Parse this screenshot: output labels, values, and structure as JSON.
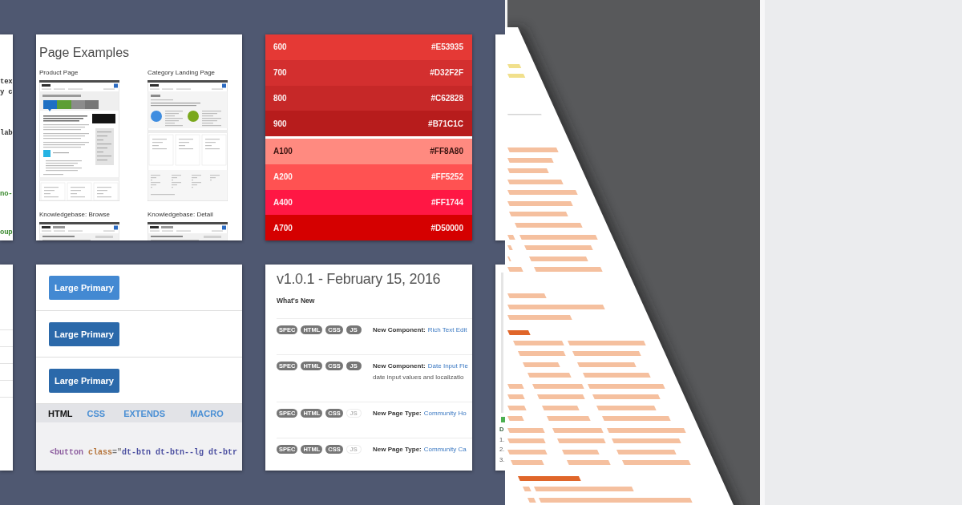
{
  "code_card": {
    "lines": [
      {
        "text": "tex",
        "color": "#333333"
      },
      {
        "text": "y c",
        "color": "#333333"
      },
      {
        "text": "lab",
        "color": "#333333"
      },
      {
        "text": "no-",
        "color": "#3a8a2e"
      },
      {
        "text": "oup",
        "color": "#3a8a2e"
      }
    ]
  },
  "page_examples_card": {
    "title": "Page Examples",
    "examples": [
      {
        "label": "Product Page",
        "kind": "product"
      },
      {
        "label": "Category Landing Page",
        "kind": "category"
      },
      {
        "label": "Knowledgebase: Browse",
        "kind": "knowledgebase"
      },
      {
        "label": "Knowledgebase: Detail",
        "kind": "knowledgebase"
      }
    ]
  },
  "palette_card": {
    "groups": [
      {
        "swatches": [
          {
            "label": "600",
            "hex": "#E53935",
            "color": "#e53935"
          },
          {
            "label": "700",
            "hex": "#D32F2F",
            "color": "#d32f2f"
          },
          {
            "label": "800",
            "hex": "#C62828",
            "color": "#c62828"
          },
          {
            "label": "900",
            "hex": "#B71C1C",
            "color": "#b71c1c"
          }
        ]
      },
      {
        "swatches": [
          {
            "label": "A100",
            "hex": "#FF8A80",
            "color": "#ff8a80"
          },
          {
            "label": "A200",
            "hex": "#FF5252",
            "color": "#ff5252"
          },
          {
            "label": "A400",
            "hex": "#FF1744",
            "color": "#ff1744"
          },
          {
            "label": "A700",
            "hex": "#D50000",
            "color": "#d50000"
          }
        ]
      }
    ]
  },
  "buttons_card": {
    "examples": [
      {
        "label": "Large Primary",
        "color": "#4389d2"
      },
      {
        "label": "Large Primary",
        "color": "#2b69aa"
      },
      {
        "label": "Large Primary",
        "color": "#2b69aa"
      }
    ],
    "code_tabs": [
      {
        "label": "HTML",
        "selected": true
      },
      {
        "label": "CSS",
        "selected": false
      },
      {
        "label": "EXTENDS",
        "selected": false
      },
      {
        "label": "MACRO",
        "selected": false
      }
    ],
    "code": [
      {
        "text": "<button",
        "color": "#8c5c9e"
      },
      {
        "text": " class",
        "color": "#b5743a"
      },
      {
        "text": "=\"",
        "color": "#777777"
      },
      {
        "text": "dt-btn dt-btn--lg dt-btr",
        "color": "#4b4fa0"
      }
    ]
  },
  "changelog_card": {
    "title": "v1.0.1 - February 15, 2016",
    "subtitle": "What's New",
    "entries": [
      {
        "tags": [
          {
            "label": "SPEC",
            "on": true
          },
          {
            "label": "HTML",
            "on": true
          },
          {
            "label": "CSS",
            "on": true
          },
          {
            "label": "JS",
            "on": true
          }
        ],
        "heading": "New Component:",
        "link": "Rich Text Edit"
      },
      {
        "tags": [
          {
            "label": "SPEC",
            "on": true
          },
          {
            "label": "HTML",
            "on": true
          },
          {
            "label": "CSS",
            "on": true
          },
          {
            "label": "JS",
            "on": true
          }
        ],
        "heading": "New Component:",
        "link": "Date Input Fie",
        "description": "date input values and localizatio"
      },
      {
        "tags": [
          {
            "label": "SPEC",
            "on": true
          },
          {
            "label": "HTML",
            "on": true
          },
          {
            "label": "CSS",
            "on": true
          },
          {
            "label": "JS",
            "on": false
          }
        ],
        "heading": "New Page Type:",
        "link": "Community Ho"
      },
      {
        "tags": [
          {
            "label": "SPEC",
            "on": true
          },
          {
            "label": "HTML",
            "on": true
          },
          {
            "label": "CSS",
            "on": true
          },
          {
            "label": "JS",
            "on": false
          }
        ],
        "heading": "New Page Type:",
        "link": "Community Ca"
      }
    ]
  },
  "side_card": {
    "heading": "D",
    "items": [
      "1.",
      "2.",
      "3."
    ]
  }
}
